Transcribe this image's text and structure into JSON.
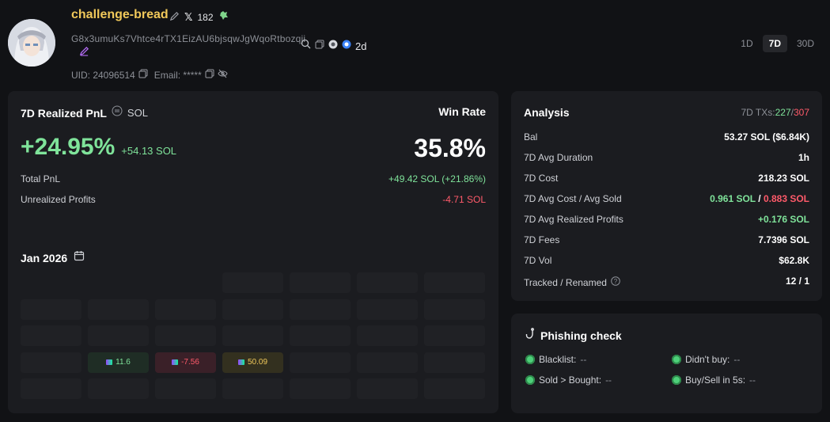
{
  "profile": {
    "name": "challenge-bread",
    "twitter_count": "182",
    "address": "G8x3umuKs7Vhtce4rTX1EizAU6bjsqwJgWqoRtbozqji",
    "age": "2d",
    "uid_label": "UID: 24096514",
    "email_label": "Email: *****"
  },
  "range_tabs": [
    "1D",
    "7D",
    "30D"
  ],
  "active_range": "7D",
  "pnl": {
    "title": "7D Realized PnL",
    "currency": "SOL",
    "percent": "+24.95%",
    "sol": "+54.13 SOL",
    "win_rate_label": "Win Rate",
    "win_rate": "35.8%",
    "rows": [
      {
        "label": "Total PnL",
        "value": "+49.42 SOL (+21.86%)",
        "tone": "green"
      },
      {
        "label": "Unrealized Profits",
        "value": "-4.71 SOL",
        "tone": "red"
      }
    ],
    "month": "Jan 2026",
    "calendar_values": [
      {
        "row": 3,
        "col": 1,
        "value": "11.6",
        "tone": "pos"
      },
      {
        "row": 3,
        "col": 2,
        "value": "-7.56",
        "tone": "neg"
      },
      {
        "row": 3,
        "col": 3,
        "value": "50.09",
        "tone": "gold"
      }
    ]
  },
  "analysis": {
    "title": "Analysis",
    "txs_label": "7D TXs:",
    "txs_buy": "227",
    "txs_sep": "/",
    "txs_sell": "307",
    "rows": [
      {
        "label": "Bal",
        "value": "53.27 SOL ($6.84K)"
      },
      {
        "label": "7D Avg Duration",
        "value": "1h"
      },
      {
        "label": "7D Cost",
        "value": "218.23 SOL"
      },
      {
        "label": "7D Avg Realized Profits",
        "value": "+0.176 SOL",
        "tone": "green"
      },
      {
        "label": "7D Fees",
        "value": "7.7396 SOL"
      },
      {
        "label": "7D Vol",
        "value": "$62.8K"
      },
      {
        "label": "Tracked / Renamed",
        "value": "12 / 1"
      }
    ],
    "avg_cost_label": "7D Avg Cost / Avg Sold",
    "avg_cost": "0.961 SOL",
    "avg_sep": "/",
    "avg_sold": "0.883 SOL"
  },
  "phishing": {
    "title": "Phishing check",
    "items": [
      {
        "label": "Blacklist:",
        "value": "--"
      },
      {
        "label": "Didn't buy:",
        "value": "--"
      },
      {
        "label": "Sold > Bought:",
        "value": "--"
      },
      {
        "label": "Buy/Sell in 5s:",
        "value": "--"
      }
    ]
  }
}
